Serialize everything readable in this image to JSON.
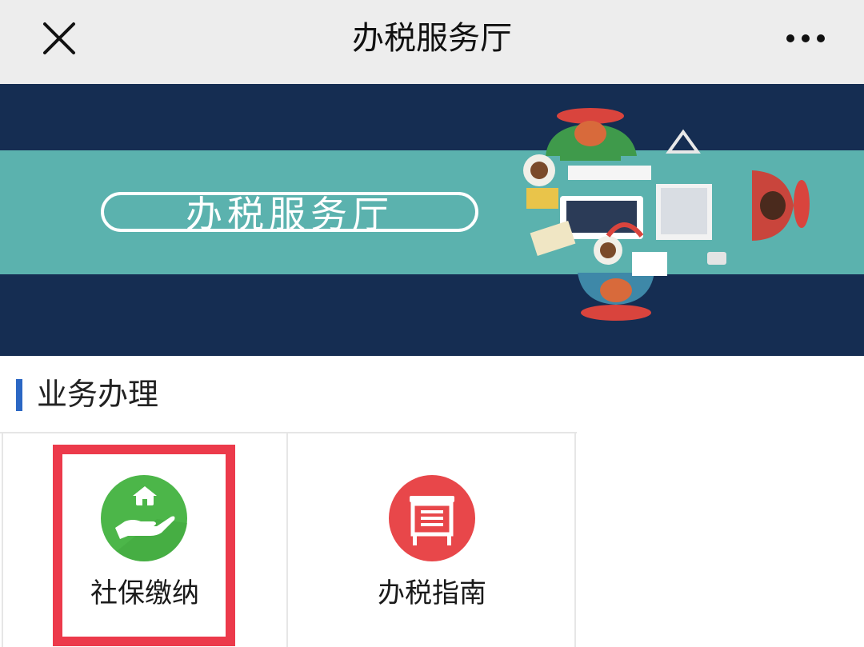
{
  "topbar": {
    "title": "办税服务厅",
    "close_icon": "close-icon",
    "more_icon": "more-icon"
  },
  "banner": {
    "text": "办税服务厅",
    "colors": {
      "dark": "#152d52",
      "band": "#5bb2ae"
    }
  },
  "section": {
    "title": "业务办理",
    "accent": "#2b67c4"
  },
  "services": [
    {
      "label": "社保缴纳",
      "icon": "hand-house-icon",
      "color": "#4cb649",
      "highlighted": true
    },
    {
      "label": "办税指南",
      "icon": "guide-board-icon",
      "color": "#e8474a",
      "highlighted": false
    }
  ],
  "highlight_color": "#ec3a4b"
}
